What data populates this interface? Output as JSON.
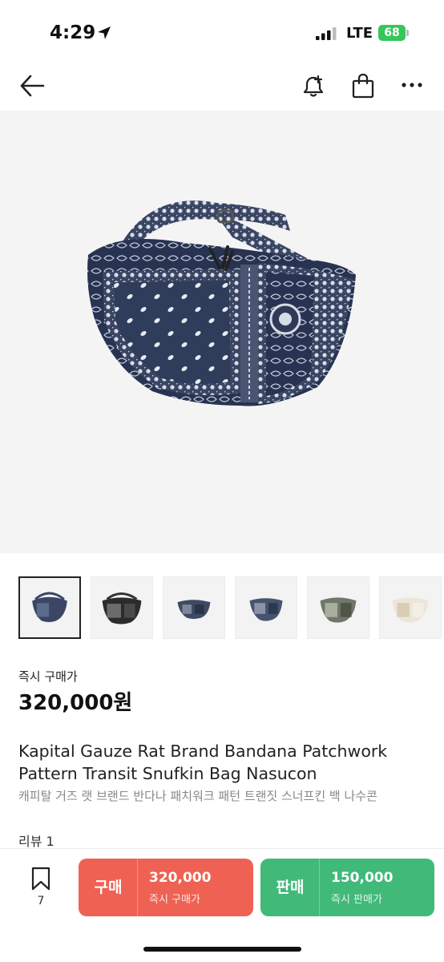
{
  "status_bar": {
    "time": "4:29",
    "network": "LTE",
    "battery": "68",
    "battery_color": "#34c759"
  },
  "nav": {
    "icons": [
      "back-arrow-icon",
      "alert-add-icon",
      "shopping-bag-icon",
      "more-dots-icon"
    ]
  },
  "product": {
    "thumbnails_count": 6,
    "price_label": "즉시 구매가",
    "price": "320,000원",
    "title_en": "Kapital Gauze Rat Brand Bandana Patchwork Pattern Transit Snufkin Bag Nasucon",
    "title_ko": "캐피탈 거즈 랫 브랜드 반다나 패치워크 패턴 트랜짓 스너프킨 백 나수콘",
    "review_link": "리뷰 1"
  },
  "bottom_bar": {
    "wish_count": "7",
    "buy": {
      "label": "구매",
      "price": "320,000",
      "sub": "즉시 구매가",
      "color": "#ef6253"
    },
    "sell": {
      "label": "판매",
      "price": "150,000",
      "sub": "즉시 판매가",
      "color": "#41b979"
    }
  }
}
